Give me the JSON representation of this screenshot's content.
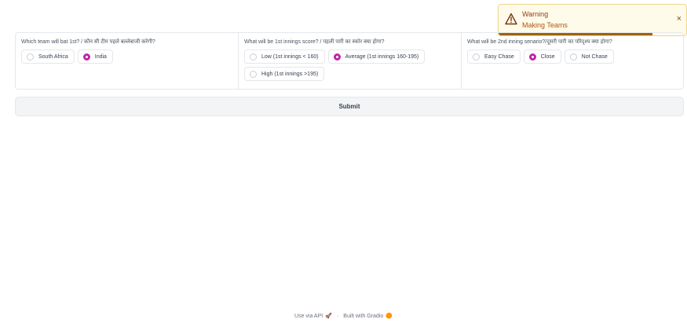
{
  "toast": {
    "title": "Warning",
    "message": "Making Teams",
    "close_glyph": "×",
    "progress": 0.82
  },
  "questions": [
    {
      "label": "Which team will bat 1st? / कौन सी टीम पहले बल्लेबाजी करेगी?",
      "options": [
        {
          "label": "South Africa",
          "selected": false
        },
        {
          "label": "India",
          "selected": true
        }
      ]
    },
    {
      "label": "What will be 1st innings score? / पहली पारी का स्कोर क्या होगा?",
      "options": [
        {
          "label": "Low (1st innings < 160)",
          "selected": false
        },
        {
          "label": "Average (1st innings 160-195)",
          "selected": true
        },
        {
          "label": "High (1st innings >195)",
          "selected": false
        }
      ]
    },
    {
      "label": "What will be 2nd inning senario?/दूसरी पारी का परिदृश्य क्या होगा?",
      "options": [
        {
          "label": "Easy Chase",
          "selected": false
        },
        {
          "label": "Close",
          "selected": true
        },
        {
          "label": "Not Chase",
          "selected": false
        }
      ]
    }
  ],
  "submit_label": "Submit",
  "footer": {
    "api_link": "Use via API",
    "separator": "·",
    "built_with": "Built with Gradio"
  },
  "colors": {
    "accent": "#c026a5",
    "warning_bg": "#fffbeb",
    "warning_text": "#92400e"
  }
}
